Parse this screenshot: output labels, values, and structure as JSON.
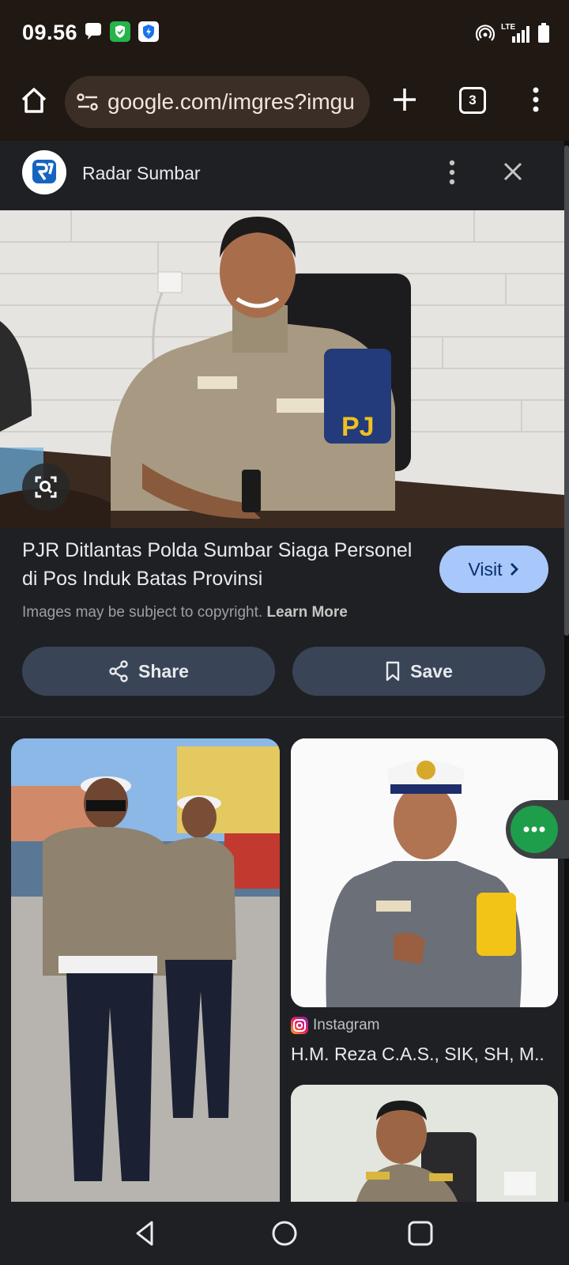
{
  "status_bar": {
    "time": "09.56",
    "network": "LTE",
    "icons": [
      "chat-bubble-icon",
      "shield-app-icon",
      "security-app-icon",
      "hotspot-icon",
      "signal-icon",
      "battery-icon"
    ]
  },
  "browser": {
    "url": "google.com/imgres?imgu",
    "tab_count": "3",
    "icons": [
      "home-icon",
      "site-settings-icon",
      "new-tab-icon",
      "tab-switcher-icon",
      "more-menu-icon"
    ]
  },
  "source": {
    "name": "Radar Sumbar"
  },
  "result": {
    "title": "PJR Ditlantas Polda Sumbar Siaga Personel di Pos Induk Batas Provinsi",
    "visit_label": "Visit",
    "copyright_text": "Images may be subject to copyright.",
    "learn_more": "Learn More",
    "share_label": "Share",
    "save_label": "Save"
  },
  "related": [
    {
      "source": "",
      "caption": ""
    },
    {
      "source": "Instagram",
      "caption": "H.M. Reza C.A.S., SIK, SH, M..."
    },
    {
      "source": "",
      "caption": ""
    }
  ],
  "colors": {
    "visit_button": "#a8c7fa",
    "action_button": "#394457",
    "chat_bubble": "#1e9e4a"
  }
}
